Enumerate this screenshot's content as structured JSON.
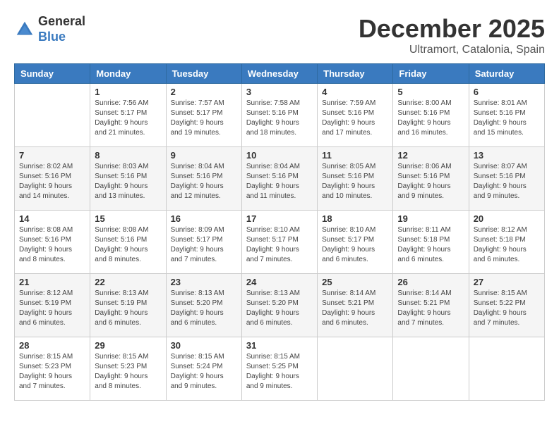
{
  "header": {
    "logo_general": "General",
    "logo_blue": "Blue",
    "month_title": "December 2025",
    "location": "Ultramort, Catalonia, Spain"
  },
  "days_of_week": [
    "Sunday",
    "Monday",
    "Tuesday",
    "Wednesday",
    "Thursday",
    "Friday",
    "Saturday"
  ],
  "weeks": [
    [
      {
        "day": "",
        "info": ""
      },
      {
        "day": "1",
        "info": "Sunrise: 7:56 AM\nSunset: 5:17 PM\nDaylight: 9 hours\nand 21 minutes."
      },
      {
        "day": "2",
        "info": "Sunrise: 7:57 AM\nSunset: 5:17 PM\nDaylight: 9 hours\nand 19 minutes."
      },
      {
        "day": "3",
        "info": "Sunrise: 7:58 AM\nSunset: 5:16 PM\nDaylight: 9 hours\nand 18 minutes."
      },
      {
        "day": "4",
        "info": "Sunrise: 7:59 AM\nSunset: 5:16 PM\nDaylight: 9 hours\nand 17 minutes."
      },
      {
        "day": "5",
        "info": "Sunrise: 8:00 AM\nSunset: 5:16 PM\nDaylight: 9 hours\nand 16 minutes."
      },
      {
        "day": "6",
        "info": "Sunrise: 8:01 AM\nSunset: 5:16 PM\nDaylight: 9 hours\nand 15 minutes."
      }
    ],
    [
      {
        "day": "7",
        "info": "Sunrise: 8:02 AM\nSunset: 5:16 PM\nDaylight: 9 hours\nand 14 minutes."
      },
      {
        "day": "8",
        "info": "Sunrise: 8:03 AM\nSunset: 5:16 PM\nDaylight: 9 hours\nand 13 minutes."
      },
      {
        "day": "9",
        "info": "Sunrise: 8:04 AM\nSunset: 5:16 PM\nDaylight: 9 hours\nand 12 minutes."
      },
      {
        "day": "10",
        "info": "Sunrise: 8:04 AM\nSunset: 5:16 PM\nDaylight: 9 hours\nand 11 minutes."
      },
      {
        "day": "11",
        "info": "Sunrise: 8:05 AM\nSunset: 5:16 PM\nDaylight: 9 hours\nand 10 minutes."
      },
      {
        "day": "12",
        "info": "Sunrise: 8:06 AM\nSunset: 5:16 PM\nDaylight: 9 hours\nand 9 minutes."
      },
      {
        "day": "13",
        "info": "Sunrise: 8:07 AM\nSunset: 5:16 PM\nDaylight: 9 hours\nand 9 minutes."
      }
    ],
    [
      {
        "day": "14",
        "info": "Sunrise: 8:08 AM\nSunset: 5:16 PM\nDaylight: 9 hours\nand 8 minutes."
      },
      {
        "day": "15",
        "info": "Sunrise: 8:08 AM\nSunset: 5:16 PM\nDaylight: 9 hours\nand 8 minutes."
      },
      {
        "day": "16",
        "info": "Sunrise: 8:09 AM\nSunset: 5:17 PM\nDaylight: 9 hours\nand 7 minutes."
      },
      {
        "day": "17",
        "info": "Sunrise: 8:10 AM\nSunset: 5:17 PM\nDaylight: 9 hours\nand 7 minutes."
      },
      {
        "day": "18",
        "info": "Sunrise: 8:10 AM\nSunset: 5:17 PM\nDaylight: 9 hours\nand 6 minutes."
      },
      {
        "day": "19",
        "info": "Sunrise: 8:11 AM\nSunset: 5:18 PM\nDaylight: 9 hours\nand 6 minutes."
      },
      {
        "day": "20",
        "info": "Sunrise: 8:12 AM\nSunset: 5:18 PM\nDaylight: 9 hours\nand 6 minutes."
      }
    ],
    [
      {
        "day": "21",
        "info": "Sunrise: 8:12 AM\nSunset: 5:19 PM\nDaylight: 9 hours\nand 6 minutes."
      },
      {
        "day": "22",
        "info": "Sunrise: 8:13 AM\nSunset: 5:19 PM\nDaylight: 9 hours\nand 6 minutes."
      },
      {
        "day": "23",
        "info": "Sunrise: 8:13 AM\nSunset: 5:20 PM\nDaylight: 9 hours\nand 6 minutes."
      },
      {
        "day": "24",
        "info": "Sunrise: 8:13 AM\nSunset: 5:20 PM\nDaylight: 9 hours\nand 6 minutes."
      },
      {
        "day": "25",
        "info": "Sunrise: 8:14 AM\nSunset: 5:21 PM\nDaylight: 9 hours\nand 6 minutes."
      },
      {
        "day": "26",
        "info": "Sunrise: 8:14 AM\nSunset: 5:21 PM\nDaylight: 9 hours\nand 7 minutes."
      },
      {
        "day": "27",
        "info": "Sunrise: 8:15 AM\nSunset: 5:22 PM\nDaylight: 9 hours\nand 7 minutes."
      }
    ],
    [
      {
        "day": "28",
        "info": "Sunrise: 8:15 AM\nSunset: 5:23 PM\nDaylight: 9 hours\nand 7 minutes."
      },
      {
        "day": "29",
        "info": "Sunrise: 8:15 AM\nSunset: 5:23 PM\nDaylight: 9 hours\nand 8 minutes."
      },
      {
        "day": "30",
        "info": "Sunrise: 8:15 AM\nSunset: 5:24 PM\nDaylight: 9 hours\nand 9 minutes."
      },
      {
        "day": "31",
        "info": "Sunrise: 8:15 AM\nSunset: 5:25 PM\nDaylight: 9 hours\nand 9 minutes."
      },
      {
        "day": "",
        "info": ""
      },
      {
        "day": "",
        "info": ""
      },
      {
        "day": "",
        "info": ""
      }
    ]
  ]
}
